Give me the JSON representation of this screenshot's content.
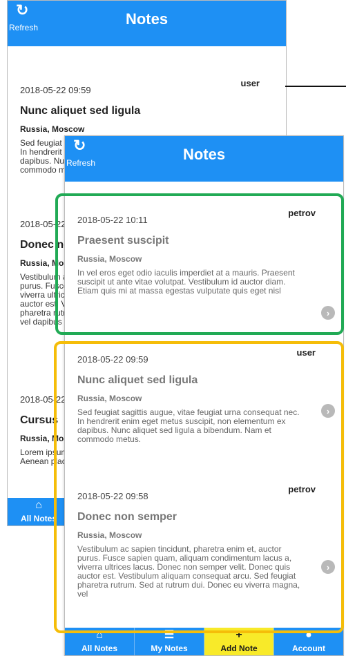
{
  "back_screen": {
    "header": {
      "refresh_label": "Refresh",
      "title": "Notes"
    },
    "notes": [
      {
        "user": "user",
        "date": "2018-05-22 09:59",
        "title": "Nunc aliquet sed ligula",
        "location": "Russia, Moscow",
        "body": "Sed feugiat sagittis augue, vitae feugiat urna consequat nec. In hendrerit enim eget metus suscipit, non elementum ex dapibus. Nunc aliquet sed ligula a bibendum. Nam et commodo metus."
      },
      {
        "user": "petrov",
        "date": "2018-05-22 09:58",
        "title": "Donec non semper",
        "location": "Russia, Moscow",
        "body": "Vestibulum ac sapien tincidunt, pharetra enim et, auctor purus. Fusce sapien quam, aliquam condimentum lacus a, viverra ultrices lacus. Donec non semper velit. Donec quis auctor est. Vestibulum aliquam consequat arcu. Sed feugiat pharetra rutrum. Sed at rutrum dui. Donec eu viverra magna, vel dapibus leo."
      },
      {
        "user": "",
        "date": "2018-05-22 09:57",
        "title": "Cursus",
        "location": "Russia, Moscow",
        "body": "Lorem ipsum dolor sit amet, consectetur adipiscing elit. Aenean placerat. Vestibulum"
      }
    ],
    "tab": {
      "label": "All Notes"
    }
  },
  "front_screen": {
    "header": {
      "refresh_label": "Refresh",
      "title": "Notes"
    },
    "notes": [
      {
        "user": "petrov",
        "date": "2018-05-22 10:11",
        "title": "Praesent suscipit",
        "location": "Russia, Moscow",
        "body": "In vel eros eget odio iaculis imperdiet at a mauris. Praesent suscipit ut ante vitae volutpat. Vestibulum id auctor diam. Etiam quis mi at massa egestas vulputate quis eget nisl"
      },
      {
        "user": "user",
        "date": "2018-05-22 09:59",
        "title": "Nunc aliquet sed ligula",
        "location": "Russia, Moscow",
        "body": "Sed feugiat sagittis augue, vitae feugiat urna consequat nec. In hendrerit enim eget metus suscipit, non elementum ex dapibus. Nunc aliquet sed ligula a bibendum. Nam et commodo metus."
      },
      {
        "user": "petrov",
        "date": "2018-05-22 09:58",
        "title": "Donec non semper",
        "location": "Russia, Moscow",
        "body": "Vestibulum ac sapien tincidunt, pharetra enim et, auctor purus. Fusce sapien quam, aliquam condimentum lacus a, viverra ultrices lacus. Donec non semper velit. Donec quis auctor est. Vestibulum aliquam consequat arcu. Sed feugiat pharetra rutrum. Sed at rutrum dui. Donec eu viverra magna, vel"
      }
    ],
    "tabs": [
      {
        "label": "All Notes",
        "icon": "home-icon"
      },
      {
        "label": "My Notes",
        "icon": "list-icon"
      },
      {
        "label": "Add Note",
        "icon": "plus-icon",
        "active": true
      },
      {
        "label": "Account",
        "icon": "person-icon"
      }
    ]
  },
  "colors": {
    "header_blue": "#1e90f4",
    "active_tab_yellow": "#f8ea29",
    "highlight_green": "#21aa55",
    "highlight_yellow": "#f5bd09"
  }
}
